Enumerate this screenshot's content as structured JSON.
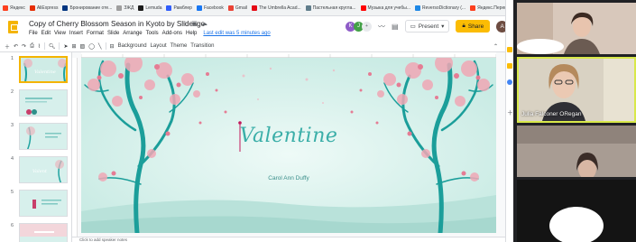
{
  "bookmarks": [
    {
      "label": "Яндекс",
      "color": "#fc3f1d"
    },
    {
      "label": "AliExpress",
      "color": "#e62e04"
    },
    {
      "label": "Бронирование оте...",
      "color": "#003580"
    },
    {
      "label": "ЗЖД",
      "color": "#9e9e9e"
    },
    {
      "label": "Lemuda",
      "color": "#1b1b1b"
    },
    {
      "label": "Рамблер",
      "color": "#315efb"
    },
    {
      "label": "Facebook",
      "color": "#1877f2"
    },
    {
      "label": "Gmail",
      "color": "#ea4335"
    },
    {
      "label": "The Umbrella Acad...",
      "color": "#e50914"
    },
    {
      "label": "Пастельная кругла...",
      "color": "#607d8b"
    },
    {
      "label": "Музыка для учебы...",
      "color": "#ff0000"
    },
    {
      "label": "ReversoDictionary (...",
      "color": "#1e88e5"
    },
    {
      "label": "Яндекс.Переводчик",
      "color": "#fc3f1d"
    }
  ],
  "doc": {
    "title": "Copy of Cherry Blossom Season in Kyoto by Slidesgo",
    "last_edit": "Last edit was 5 minutes ago"
  },
  "menu": [
    "File",
    "Edit",
    "View",
    "Insert",
    "Format",
    "Slide",
    "Arrange",
    "Tools",
    "Add-ons",
    "Help"
  ],
  "header": {
    "avatar_k": "K",
    "avatar_j": "J",
    "present_label": "Present",
    "share_label": "Share",
    "user_initial": "A"
  },
  "toolbar": {
    "background_label": "Background",
    "layout_label": "Layout",
    "theme_label": "Theme",
    "transition_label": "Transition"
  },
  "filmstrip": {
    "slide_numbers": [
      "1",
      "2",
      "3",
      "4",
      "5",
      "6"
    ]
  },
  "slide": {
    "title": "Valentine",
    "subtitle": "Carol Ann Duffy"
  },
  "notes": {
    "placeholder": "Click to add speaker notes"
  },
  "video": {
    "participant_name": "Julia Falconer ORegan"
  },
  "colors": {
    "accent": "#f4b400",
    "slide_bg": "#e4f5f1",
    "title": "#3aaea8",
    "active_speaker": "#d8e84a"
  }
}
